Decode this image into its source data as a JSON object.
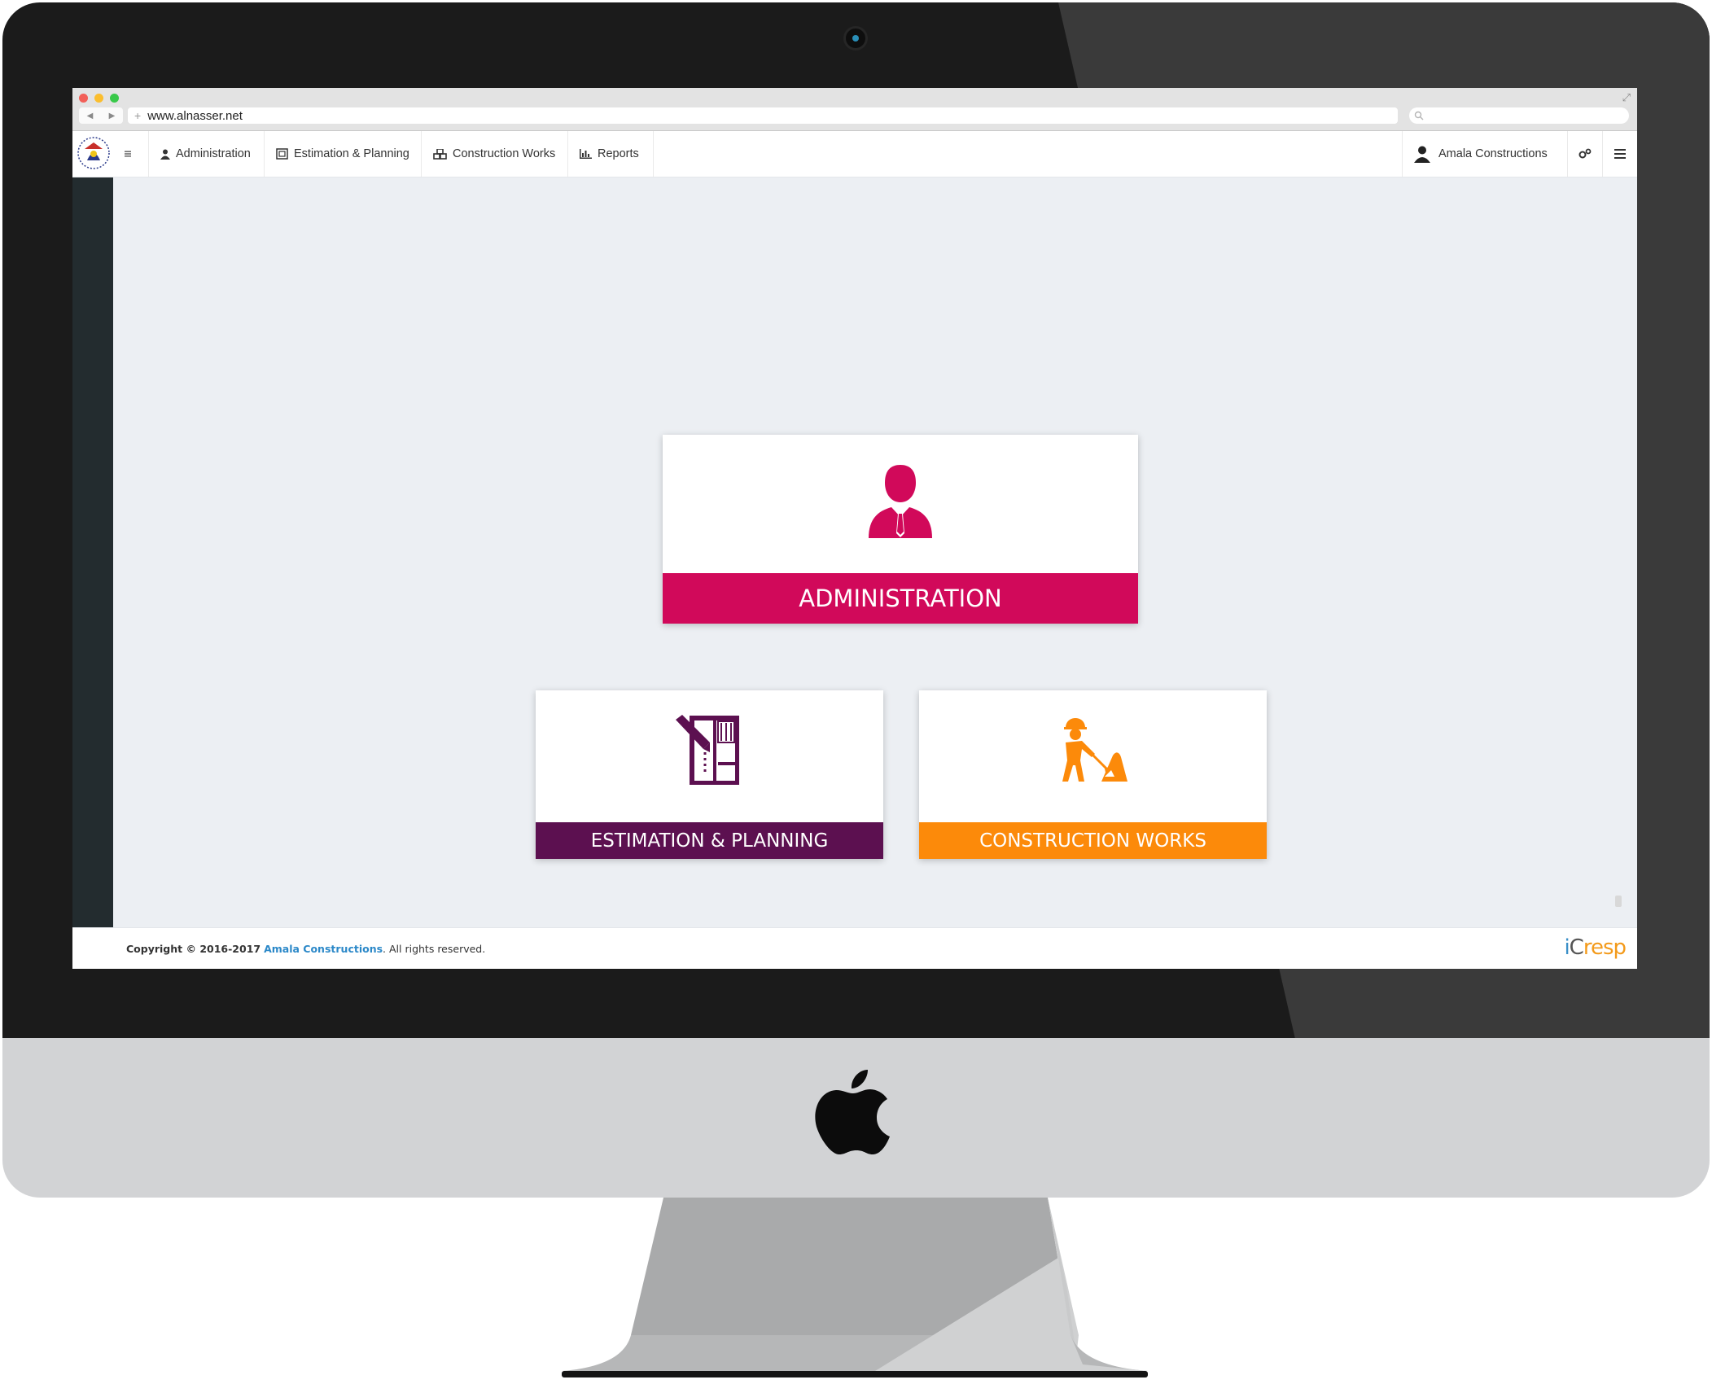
{
  "browser": {
    "url": "www.alnasser.net"
  },
  "header": {
    "nav": [
      {
        "label": "Administration",
        "icon": "user-icon"
      },
      {
        "label": "Estimation & Planning",
        "icon": "blueprint-icon"
      },
      {
        "label": "Construction Works",
        "icon": "cubes-icon"
      },
      {
        "label": "Reports",
        "icon": "bar-chart-icon"
      }
    ],
    "user_name": "Amala Constructions",
    "icons": [
      "hamburger-icon",
      "settings-icon",
      "menu-icon"
    ]
  },
  "tiles": {
    "administration": {
      "label": "ADMINISTRATION",
      "color": "#d1095a",
      "icon": "businessman-icon"
    },
    "estimation": {
      "label": "ESTIMATION & PLANNING",
      "color": "#5c1050",
      "icon": "blueprint-plan-icon"
    },
    "construction": {
      "label": "CONSTRUCTION WORKS",
      "color": "#fc8a0a",
      "icon": "worker-shovel-icon"
    }
  },
  "footer": {
    "prefix": "Copyright © 2016-2017",
    "company": "Amala Constructions",
    "suffix": ". All rights reserved.",
    "brand_part1": "i",
    "brand_part2": "C",
    "brand_part3": "resp"
  },
  "colors": {
    "sidebar": "#232c2f",
    "content_bg": "#eceff3",
    "bezel": "#1b1b1b",
    "chin": "#d2d3d5"
  }
}
